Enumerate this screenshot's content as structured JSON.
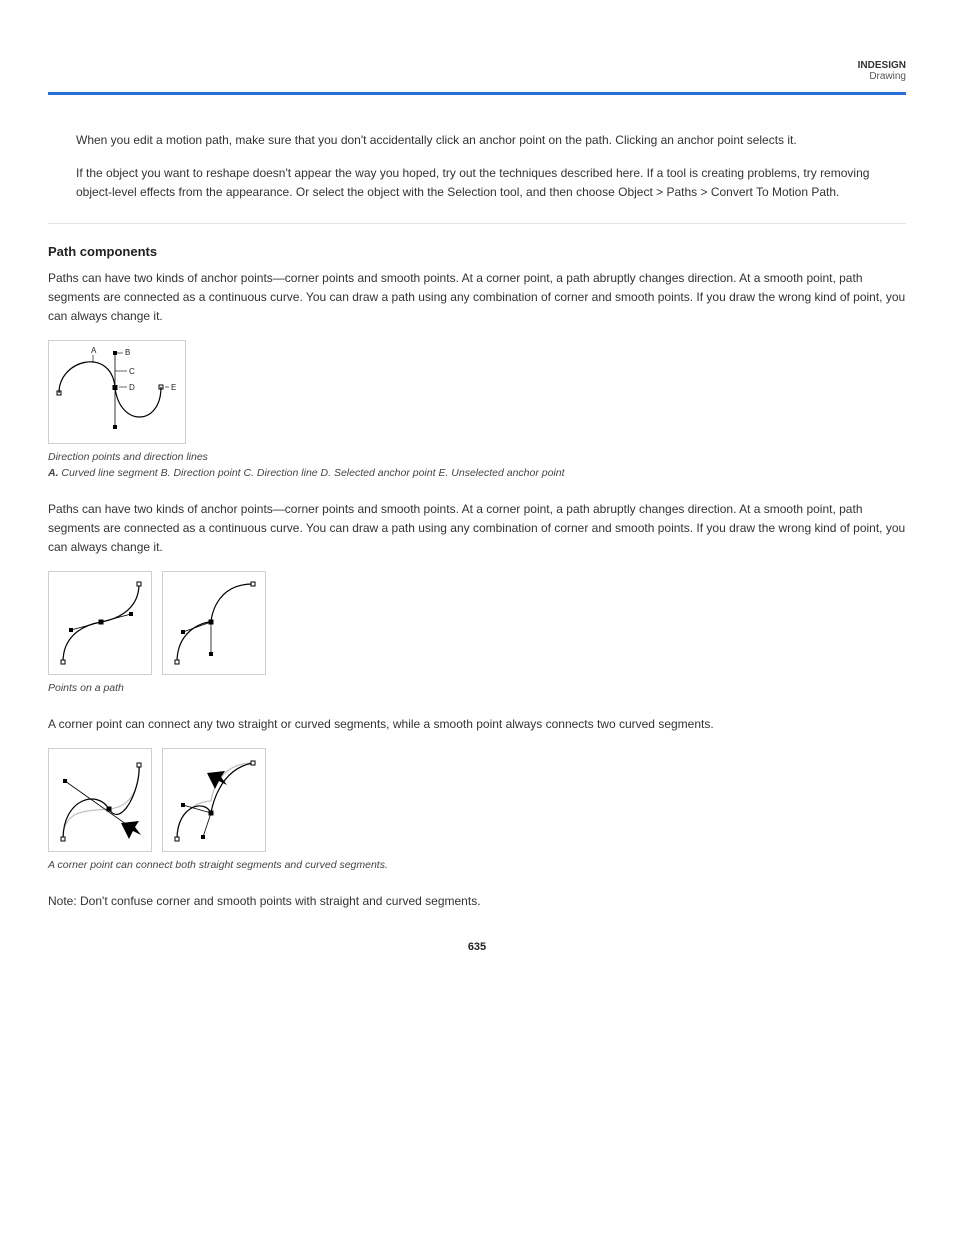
{
  "header": {
    "product": "INDESIGN",
    "section": "Drawing"
  },
  "intro": {
    "p1": "When you edit a motion path, make sure that you don't accidentally click an anchor point on the path. Clicking an anchor point selects it.",
    "p2_prefix": "If the object you want to reshape doesn't appear the way you hoped, try out the techniques described here. If a tool is creating problems, try removing object-level effects from the appearance. Or select the object with the Selection tool, and then choose",
    "p2_menu": "Object > Paths > Convert To Motion Path."
  },
  "components": {
    "heading": "Path components",
    "p1": "Paths can have two kinds of anchor points—corner points and smooth points. At a corner point, a path abruptly changes direction. At a smooth point, path segments are connected as a continuous curve. You can draw a path using any combination of corner and smooth points. If you draw the wrong kind of point, you can always change it.",
    "table": {
      "caption_line1": "Direction points and direction lines",
      "caption_line2_prefix": "A. ",
      "caption_line2": "Curved line segment   B.  Direction point   C.  Direction line   D.  Selected anchor point   E.  Unselected anchor point"
    },
    "p2": "Paths can have two kinds of anchor points—corner points and smooth points. At a corner point, a path abruptly changes direction. At a smooth point, path segments are connected as a continuous curve. You can draw a path using any combination of corner and smooth points. If you draw the wrong kind of point, you can always change it.",
    "fig2_caption": "Points on a path",
    "p3": "A corner point can connect any two straight or curved segments, while a smooth point always connects two curved segments.",
    "fig3_caption": "A corner point can connect both straight segments and curved segments.",
    "p4": "Note: Don't confuse corner and smooth points with straight and curved segments."
  },
  "page_number": "635",
  "chart_data": [
    {
      "type": "diagram",
      "title": "Direction points and direction lines",
      "labels": [
        "A",
        "B",
        "C",
        "D",
        "E"
      ],
      "legend": {
        "A": "Curved line segment",
        "B": "Direction point",
        "C": "Direction line",
        "D": "Selected anchor point",
        "E": "Unselected anchor point"
      }
    },
    {
      "type": "diagram",
      "title": "Points on a path",
      "panels": 2,
      "description": "Left: smooth point with symmetric direction handles on an S-curve. Right: corner point where two curve segments meet at an angle."
    },
    {
      "type": "diagram",
      "title": "A corner point can connect both straight segments and curved segments.",
      "panels": 2,
      "description": "Left: corner point between two curved segments (arrow cursor near point). Right: corner point connecting straight and curved segment (arrow cursor near handle)."
    }
  ]
}
